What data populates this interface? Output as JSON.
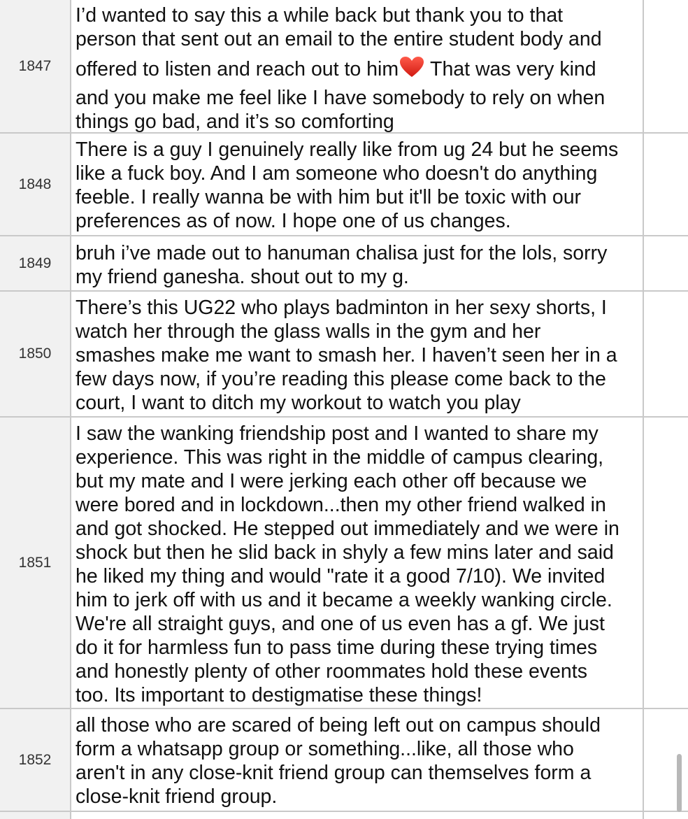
{
  "rows": [
    {
      "id": "1847",
      "lines": [
        "I’d wanted to say this a while back but thank you to that",
        "person that sent out an email to the entire student body and",
        "offered to listen and reach out to him",
        "and you make me feel like I have somebody to rely on when",
        "things go bad, and it’s so comforting"
      ],
      "heart_tail": "That was very kind"
    },
    {
      "id": "1848",
      "lines": [
        "There is a guy I genuinely really like from ug 24 but he seems",
        "like a fuck boy. And I am someone who doesn't do anything",
        "feeble. I really wanna be with him but it'll be toxic with our",
        "preferences as of now. I hope one of us changes."
      ]
    },
    {
      "id": "1849",
      "lines": [
        "bruh i’ve made out to hanuman chalisa just for the lols, sorry",
        "my friend ganesha. shout out to my g."
      ]
    },
    {
      "id": "1850",
      "lines": [
        "There’s this UG22 who plays badminton in her sexy shorts, I",
        "watch her through the glass walls in the gym and her",
        "smashes make me want to smash her. I haven’t seen her in a",
        "few days now, if you’re reading this please come back to the",
        "court, I want to ditch my workout to watch you play"
      ]
    },
    {
      "id": "1851",
      "lines": [
        "I saw the wanking friendship post and I wanted to share my",
        "experience. This was right in the middle of campus clearing,",
        "but my mate and I were jerking each other off because we",
        "were bored and in lockdown...then my other friend walked in",
        "and got shocked. He stepped out immediately and we were in",
        "shock but then he slid back in shyly a few mins later and said",
        "he liked my thing and would \"rate it a good 7/10). We invited",
        "him to jerk off with us and it became a weekly wanking circle.",
        "We're all straight guys, and one of us even has a gf. We just",
        "do it for harmless fun to pass time during these trying times",
        "and honestly plenty of other roommates hold these events",
        "too. Its important to destigmatise these things!"
      ]
    },
    {
      "id": "1852",
      "lines": [
        "all those who are scared of being left out on campus should",
        "form a whatsapp group or something...like, all those who",
        "aren't in any close-knit friend group can themselves form a",
        "close-knit friend group."
      ]
    }
  ],
  "icons": {
    "heart": "heart-icon"
  },
  "colors": {
    "grid": "#c9c9c9",
    "row_header_bg": "#f1f1f1",
    "heart": "#e0241c"
  }
}
